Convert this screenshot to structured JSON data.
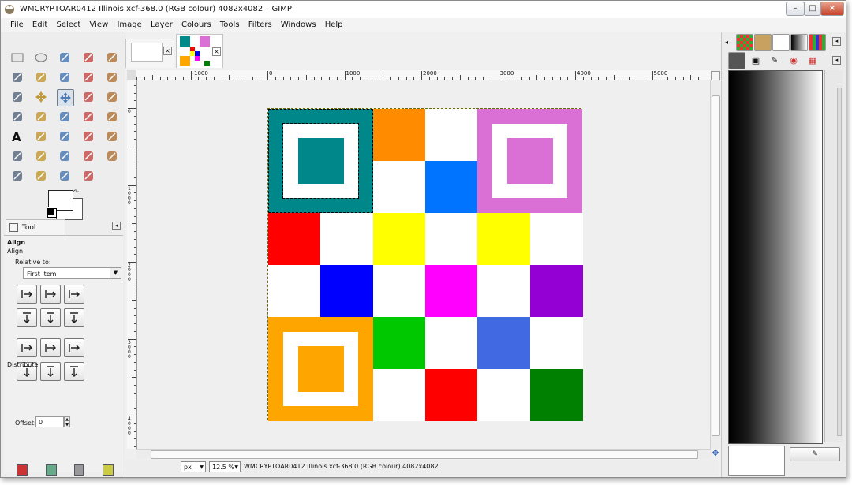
{
  "window": {
    "title": "WMCRYPTOAR0412 Illinois.xcf-368.0 (RGB colour) 4082x4082 – GIMP",
    "controls": [
      "minimize-icon",
      "maximize-icon",
      "close-icon"
    ]
  },
  "menubar": {
    "items": [
      "File",
      "Edit",
      "Select",
      "View",
      "Image",
      "Layer",
      "Colours",
      "Tools",
      "Filters",
      "Windows",
      "Help"
    ]
  },
  "toolbox": {
    "tools": [
      "rect-select-icon",
      "ellipse-select-icon",
      "lasso-icon",
      "fuzzy-select-icon",
      "color-select-icon",
      "scissors-icon",
      "foreground-select-icon",
      "paths-icon",
      "color-picker-icon",
      "zoom-icon",
      "measure-icon",
      "move-icon",
      "align-icon",
      "transform-icon",
      "rotate-icon",
      "scale-icon",
      "shear-icon",
      "perspective-icon",
      "flip-icon",
      "cage-icon",
      "text-icon",
      "bucket-fill-icon",
      "blend-icon",
      "pencil-icon",
      "paintbrush-icon",
      "eraser-icon",
      "airbrush-icon",
      "ink-icon",
      "clone-icon",
      "heal-icon",
      "perspective-clone-icon",
      "blur-icon",
      "smudge-icon",
      "dodge-burn-icon"
    ],
    "active_tool": "align-icon",
    "fg_color": "#ffffff",
    "bg_color": "#ffffff"
  },
  "tool_options": {
    "tab_label": "Tool Options",
    "heading": "Align",
    "subheading": "Align",
    "relative_label": "Relative to:",
    "relative_value": "First item",
    "distribute_label": "Distribute",
    "offset_label": "Offset:",
    "offset_value": "0"
  },
  "image_tabs": [
    {
      "name": "blank-image-tab"
    },
    {
      "name": "pattern-image-tab",
      "active": true
    }
  ],
  "rulers": {
    "h_labels": [
      "-1000",
      "0",
      "1000",
      "2000",
      "3000",
      "4000",
      "5000"
    ],
    "v_labels": [
      "0",
      "1000",
      "2000",
      "3000",
      "4000"
    ]
  },
  "statusbar": {
    "unit": "px",
    "zoom": "12.5 %",
    "info": "WMCRYPTOAR0412 Illinois.xcf-368.0 (RGB colour) 4082x4082"
  },
  "image_colors": {
    "teal": "#00878a",
    "orange": "#ff8c00",
    "amber": "#ffa500",
    "blue_azure": "#0073ff",
    "orchid": "#da70d6",
    "red": "#ff0000",
    "yellow": "#ffff00",
    "blue": "#0000ff",
    "magenta": "#ff00ff",
    "purple": "#9400d3",
    "green_lime": "#00c800",
    "royal_blue": "#4169e1",
    "green": "#008000",
    "white": "#ffffff"
  }
}
